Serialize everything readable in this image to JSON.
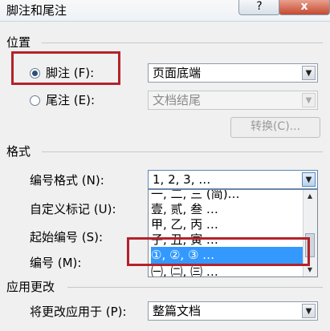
{
  "window": {
    "title": "脚注和尾注",
    "help_icon": "?",
    "close_icon": "x"
  },
  "position": {
    "section_label": "位置",
    "footnote": {
      "label": "脚注 (F):",
      "selected": true,
      "value": "页面底端"
    },
    "endnote": {
      "label": "尾注 (E):",
      "selected": false,
      "value": "文档结尾"
    },
    "convert_button": "转换(C)..."
  },
  "format": {
    "section_label": "格式",
    "number_format": {
      "label": "编号格式 (N):",
      "value": "1, 2, 3, …"
    },
    "custom_mark": {
      "label": "自定义标记 (U):"
    },
    "start_at": {
      "label": "起始编号 (S):"
    },
    "numbering": {
      "label": "编号 (M):"
    },
    "dropdown_options": [
      "一, 二, 三 (简)…",
      "壹, 贰, 叁 …",
      "甲, 乙, 丙 …",
      "子, 丑, 寅 …",
      "①, ②, ③ …",
      "㈠, ㈡, ㈢ …"
    ],
    "highlighted_index": 4
  },
  "apply": {
    "section_label": "应用更改",
    "apply_to": {
      "label": "将更改应用于 (P):",
      "value": "整篇文档"
    }
  },
  "colors": {
    "highlight": "#3399ff",
    "annotation_red": "#b3222a"
  }
}
